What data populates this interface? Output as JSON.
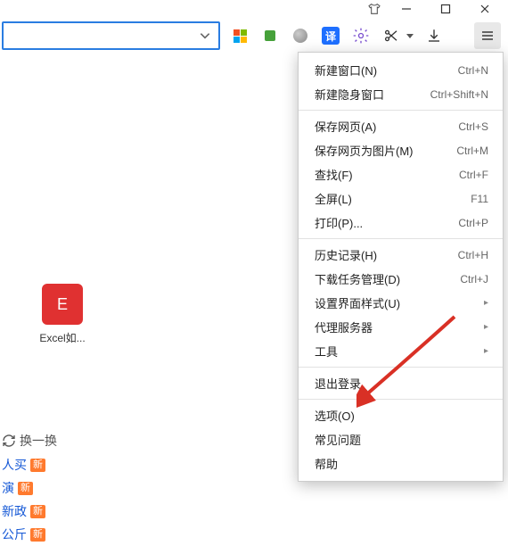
{
  "titlebar": {
    "shirt": "shirt",
    "minimize": "minimize",
    "maximize": "maximize",
    "close": "close"
  },
  "toolbar": {
    "translate_glyph": "译",
    "scissors": "scissors",
    "download": "download",
    "menu": "menu"
  },
  "tile": {
    "letter": "E",
    "label": "Excel如..."
  },
  "side": {
    "refresh": "换一换",
    "items": [
      {
        "text": "人买",
        "badge": "新"
      },
      {
        "text": "演",
        "badge": "新"
      },
      {
        "text": "新政",
        "badge": "新"
      },
      {
        "text": "公斤",
        "badge": "新"
      }
    ]
  },
  "menu": [
    {
      "type": "item",
      "label": "新建窗口(N)",
      "shortcut": "Ctrl+N"
    },
    {
      "type": "item",
      "label": "新建隐身窗口",
      "shortcut": "Ctrl+Shift+N"
    },
    {
      "type": "sep"
    },
    {
      "type": "item",
      "label": "保存网页(A)",
      "shortcut": "Ctrl+S"
    },
    {
      "type": "item",
      "label": "保存网页为图片(M)",
      "shortcut": "Ctrl+M"
    },
    {
      "type": "item",
      "label": "查找(F)",
      "shortcut": "Ctrl+F"
    },
    {
      "type": "item",
      "label": "全屏(L)",
      "shortcut": "F11"
    },
    {
      "type": "item",
      "label": "打印(P)...",
      "shortcut": "Ctrl+P"
    },
    {
      "type": "sep"
    },
    {
      "type": "item",
      "label": "历史记录(H)",
      "shortcut": "Ctrl+H"
    },
    {
      "type": "item",
      "label": "下载任务管理(D)",
      "shortcut": "Ctrl+J"
    },
    {
      "type": "sub",
      "label": "设置界面样式(U)"
    },
    {
      "type": "sub",
      "label": "代理服务器"
    },
    {
      "type": "sub",
      "label": "工具"
    },
    {
      "type": "sep"
    },
    {
      "type": "item",
      "label": "退出登录"
    },
    {
      "type": "sep"
    },
    {
      "type": "item",
      "label": "选项(O)"
    },
    {
      "type": "item",
      "label": "常见问题"
    },
    {
      "type": "item",
      "label": "帮助"
    }
  ]
}
